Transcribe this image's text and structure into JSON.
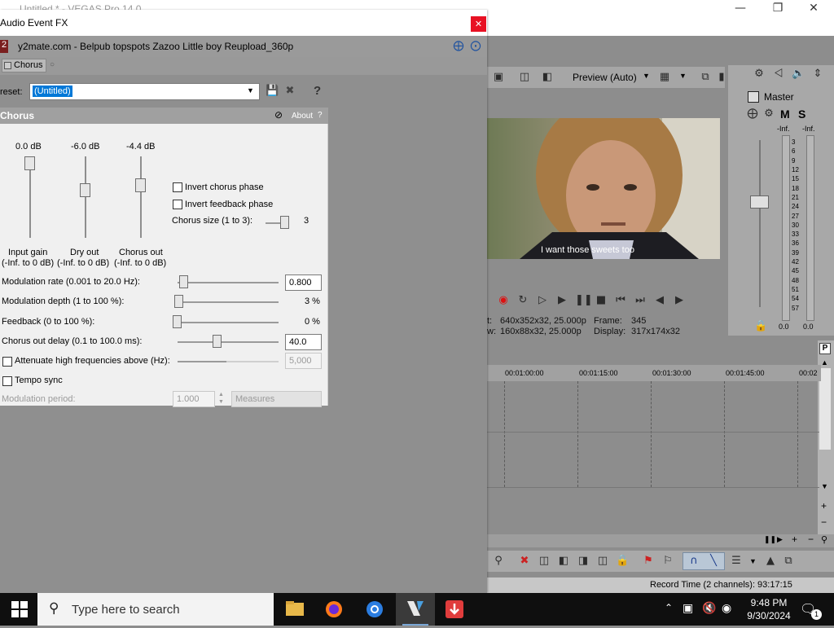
{
  "vegas": {
    "title": "Untitled * - VEGAS Pro 14.0",
    "preview": {
      "quality": "Preview (Auto)",
      "subtitle": "I want those sweets too",
      "info_rows": [
        {
          "label": "t:",
          "value": "640x352x32, 25.000p",
          "label2": "Frame:",
          "value2": "345"
        },
        {
          "label": "w:",
          "value": "160x88x32, 25.000p",
          "label2": "Display:",
          "value2": "317x174x32"
        }
      ]
    },
    "master": {
      "title": "Master",
      "m_label": "M",
      "s_label": "S",
      "peak_left": "-Inf.",
      "peak_right": "-Inf.",
      "scale": [
        "3",
        "6",
        "9",
        "12",
        "15",
        "18",
        "21",
        "24",
        "27",
        "30",
        "33",
        "36",
        "39",
        "42",
        "45",
        "48",
        "51",
        "54",
        "57"
      ],
      "level_left": "0.0",
      "level_right": "0.0"
    },
    "timeline": {
      "ruler": [
        "00:01:00:00",
        "00:01:15:00",
        "00:01:30:00",
        "00:01:45:00",
        "00:02"
      ]
    },
    "status": "Record Time (2 channels): 93:17:15"
  },
  "fx": {
    "title": "Audio Event FX",
    "badge": "2",
    "event_name": "y2mate.com - Belpub topspots Zazoo  Little boy Reupload_360p",
    "chain_plugin": "Chorus",
    "preset_label": "reset:",
    "preset_value": "(Untitled)",
    "plugin_name": "Chorus",
    "about": "About",
    "help": "?",
    "sliders": [
      {
        "value": "0.0 dB",
        "name": "Input gain",
        "range": "(-Inf. to 0 dB)",
        "level": 1.0
      },
      {
        "value": "-6.0 dB",
        "name": "Dry out",
        "range": "(-Inf. to 0 dB)",
        "level": 0.6
      },
      {
        "value": "-4.4 dB",
        "name": "Chorus out",
        "range": "(-Inf. to 0 dB)",
        "level": 0.68
      }
    ],
    "invert_chorus": "Invert chorus phase",
    "invert_feedback": "Invert feedback phase",
    "chorus_size_label": "Chorus size (1 to 3):",
    "chorus_size_value": "3",
    "mod_rate_label": "Modulation rate (0.001 to 20.0 Hz):",
    "mod_rate_value": "0.800",
    "mod_depth_label": "Modulation depth (1 to 100 %):",
    "mod_depth_value": "3 %",
    "feedback_label": "Feedback (0 to 100 %):",
    "feedback_value": "0 %",
    "delay_label": "Chorus out delay (0.1 to 100.0 ms):",
    "delay_value": "40.0",
    "attenuate_label": "Attenuate high frequencies above (Hz):",
    "attenuate_value": "5,000",
    "tempo_label": "Tempo sync",
    "mod_period_label": "Modulation period:",
    "mod_period_value": "1.000",
    "measures": "Measures"
  },
  "taskbar": {
    "search_placeholder": "Type here to search",
    "time": "9:48 PM",
    "date": "9/30/2024",
    "notification_count": "1"
  }
}
